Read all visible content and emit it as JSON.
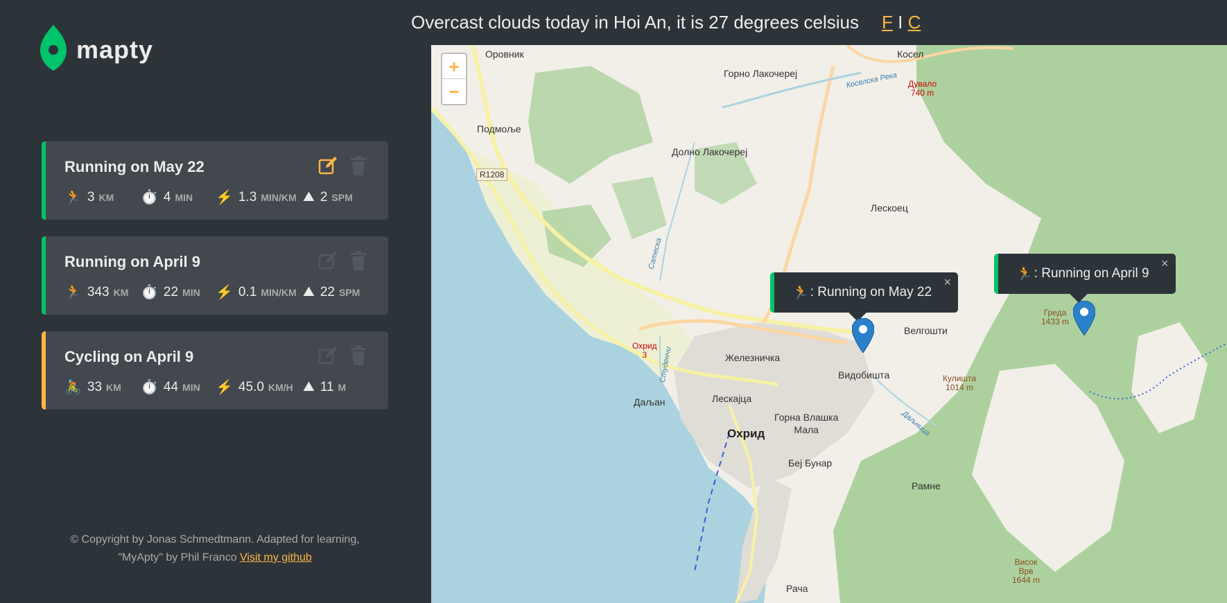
{
  "header": {
    "weather_text": "Overcast clouds today in Hoi An, it is 27 degrees celsius",
    "unit_f": "F",
    "unit_sep": " I ",
    "unit_c": "C"
  },
  "logo": {
    "text": "mapty",
    "icon": "map-pin-icon"
  },
  "workouts": [
    {
      "type": "running",
      "title": "Running on May 22",
      "distance": "3",
      "distance_unit": "km",
      "duration": "4",
      "duration_unit": "min",
      "pace": "1.3",
      "pace_unit": "min/km",
      "cadence": "2",
      "cadence_unit": "spm",
      "icon": "runner-icon"
    },
    {
      "type": "running",
      "title": "Running on April 9",
      "distance": "343",
      "distance_unit": "km",
      "duration": "22",
      "duration_unit": "min",
      "pace": "0.1",
      "pace_unit": "min/km",
      "cadence": "22",
      "cadence_unit": "spm",
      "icon": "runner-icon"
    },
    {
      "type": "cycling",
      "title": "Cycling on April 9",
      "distance": "33",
      "distance_unit": "km",
      "duration": "44",
      "duration_unit": "min",
      "pace": "45.0",
      "pace_unit": "km/h",
      "cadence": "11",
      "cadence_unit": "m",
      "icon": "cyclist-icon"
    }
  ],
  "footer": {
    "copyright": "© Copyright by Jonas Schmedtmann. Adapted for learning,",
    "credit": "\"MyApty\" by Phil Franco ",
    "link": "Visit my github"
  },
  "map": {
    "zoom_in": "+",
    "zoom_out": "−",
    "popups": [
      {
        "label": ": Running on May 22",
        "close": "×"
      },
      {
        "label": ": Running on April 9",
        "close": "×"
      }
    ],
    "labels": {
      "orovnik": "Оровник",
      "kosel": "Косел",
      "gorno": "Горно Лакочерej",
      "river_kosel": "Коселска Река",
      "duvalo": "Дувало",
      "duvalo_h": "740 m",
      "podmolje": "Подмоље",
      "dolno": "Долно Лакочерej",
      "r1208": "R1208",
      "leskoec": "Лескоец",
      "velgoshti": "Велгошти",
      "greda": "Греда",
      "greda_h": "1433 m",
      "zheleznichka": "Железничка",
      "vidobishta": "Видобишта",
      "ohrid3": "Охрид",
      "ohrid3_n": "3",
      "kulishta": "Кулишта",
      "kulishta_h": "1014 m",
      "daljan": "Даљан",
      "leskajca": "Лескајца",
      "gorna": "Горна Влашка",
      "mala": "Мала",
      "ohrid": "Охрид",
      "bej": "Беј Бунар",
      "ramne": "Рамне",
      "visok": "Висок",
      "vrv": "Врв",
      "visok_h": "1644 m",
      "racha": "Рача",
      "dabnitsa": "Даљница",
      "studench": "Студенчи",
      "sateska": "Сатеска"
    }
  }
}
